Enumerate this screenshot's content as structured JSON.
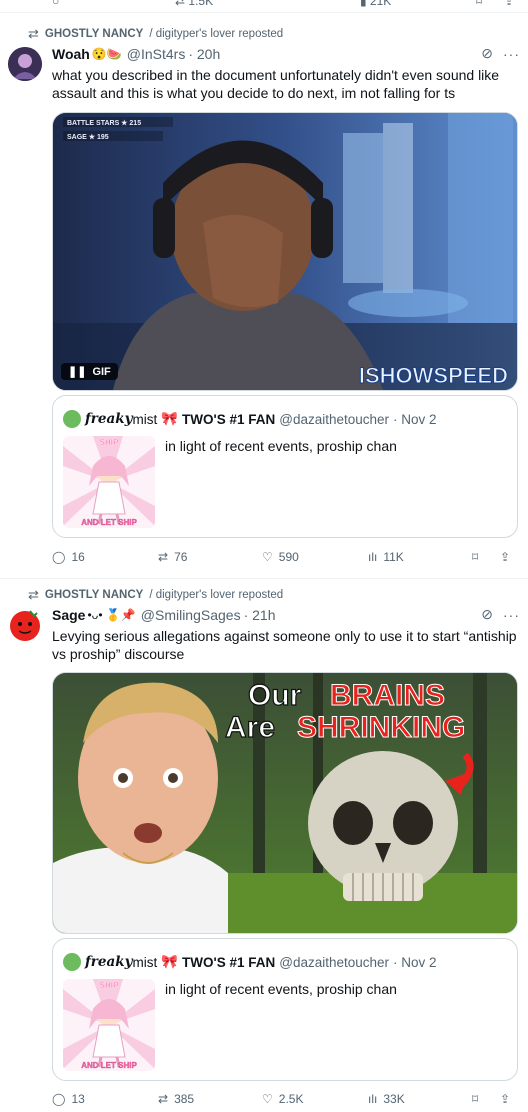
{
  "top_counts": {
    "replies": "",
    "reposts": "1.5K",
    "views": "21K"
  },
  "tweets": [
    {
      "repost_by": "GHOSTLY NANCY",
      "repost_by_suffix": "/ digityper's lover reposted",
      "name": "Woah",
      "emoji": "😯🍉",
      "handle": "@InSt4rs",
      "time": "· 20h",
      "text": "what you described in the document unfortunately didn't even sound like assault and this is what you decide to do next, im not falling for ts",
      "media": {
        "type": "gif",
        "badge": "GIF",
        "watermark": "ISHOWSPEED",
        "hud": [
          "BATTLE STARS ★ 215",
          "SAGE ★ 195"
        ]
      },
      "quote": {
        "name_a": "freaky",
        "name_b": "mist",
        "name_c": "TWO'S #1 FAN",
        "handle": "@dazaithetoucher",
        "time": "· Nov 2",
        "text": "in light of recent events, proship chan",
        "thumb_top": "SHIP",
        "thumb_bottom": "AND LET SHIP"
      },
      "stats": {
        "replies": "16",
        "reposts": "76",
        "likes": "590",
        "views": "11K"
      }
    },
    {
      "repost_by": "GHOSTLY NANCY",
      "repost_by_suffix": "/ digityper's lover reposted",
      "name": "Sage",
      "emoji": "•ᴗ• 🥇📌",
      "handle": "@SmilingSages",
      "time": "· 21h",
      "text": "Levying serious allegations against someone only to use it to start “antiship vs proship” discourse",
      "media": {
        "type": "image",
        "line1_white": "Our",
        "line1_red": "BRAINS",
        "line2_white": "Are",
        "line2_red": "SHRINKING"
      },
      "quote": {
        "name_a": "freaky",
        "name_b": "mist",
        "name_c": "TWO'S #1 FAN",
        "handle": "@dazaithetoucher",
        "time": "· Nov 2",
        "text": "in light of recent events, proship chan",
        "thumb_top": "SHIP",
        "thumb_bottom": "AND LET SHIP"
      },
      "stats": {
        "replies": "13",
        "reposts": "385",
        "likes": "2.5K",
        "views": "33K"
      }
    }
  ],
  "colors": {
    "muted": "#536471",
    "border": "#cfd9de",
    "text": "#0f1419",
    "red_headline": "#e8231e"
  }
}
